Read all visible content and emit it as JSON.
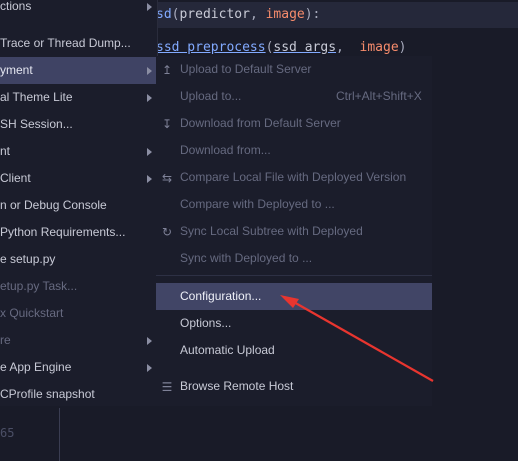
{
  "editor": {
    "line1": {
      "fn": "sd",
      "open": "(",
      "arg1": "predictor",
      "comma": ",",
      "arg2": "image",
      "close": "):"
    },
    "line2": {
      "fn": "ssd",
      "fn_rest": " preprocess",
      "open": "(",
      "arg1": "ssd args",
      "comma": ",",
      "arg2": "image",
      "close": ")"
    },
    "line3": "' ' ' ' ' ' ' ' '",
    "gutter_number": "65"
  },
  "parent_menu": {
    "items": [
      {
        "label": "ctions",
        "has_submenu": true,
        "disabled": false,
        "selected": false
      },
      {
        "label": " Trace or Thread Dump...",
        "has_submenu": false,
        "disabled": false,
        "selected": false
      },
      {
        "label": "yment",
        "has_submenu": true,
        "disabled": false,
        "selected": true
      },
      {
        "label": "al Theme Lite",
        "has_submenu": true,
        "disabled": false,
        "selected": false
      },
      {
        "label": "SH Session...",
        "has_submenu": false,
        "disabled": false,
        "selected": false
      },
      {
        "label": "nt",
        "has_submenu": true,
        "disabled": false,
        "selected": false
      },
      {
        "label": " Client",
        "has_submenu": true,
        "disabled": false,
        "selected": false
      },
      {
        "label": "n or Debug Console",
        "has_submenu": false,
        "disabled": false,
        "selected": false
      },
      {
        "label": "Python Requirements...",
        "has_submenu": false,
        "disabled": false,
        "selected": false
      },
      {
        "label": "e setup.py",
        "has_submenu": false,
        "disabled": false,
        "selected": false
      },
      {
        "label": "etup.py Task...",
        "has_submenu": false,
        "disabled": true,
        "selected": false
      },
      {
        "label": "x Quickstart",
        "has_submenu": false,
        "disabled": true,
        "selected": false
      },
      {
        "label": "re",
        "has_submenu": true,
        "disabled": true,
        "selected": false
      },
      {
        "label": "e App Engine",
        "has_submenu": true,
        "disabled": false,
        "selected": false
      },
      {
        "label": "CProfile snapshot",
        "has_submenu": false,
        "disabled": false,
        "selected": false
      }
    ]
  },
  "submenu": {
    "items": [
      {
        "label": "Upload to Default Server",
        "icon": "upload-icon",
        "icon_glyph": "↥",
        "disabled": true,
        "shortcut": ""
      },
      {
        "label": "Upload to...",
        "icon": "",
        "icon_glyph": "",
        "disabled": true,
        "shortcut": "Ctrl+Alt+Shift+X"
      },
      {
        "label": "Download from Default Server",
        "icon": "download-icon",
        "icon_glyph": "↧",
        "disabled": true,
        "shortcut": ""
      },
      {
        "label": "Download from...",
        "icon": "",
        "icon_glyph": "",
        "disabled": true,
        "shortcut": ""
      },
      {
        "label": "Compare Local File with Deployed Version",
        "icon": "compare-icon",
        "icon_glyph": "⇆",
        "disabled": true,
        "shortcut": ""
      },
      {
        "label": "Compare with Deployed to ...",
        "icon": "",
        "icon_glyph": "",
        "disabled": true,
        "shortcut": ""
      },
      {
        "label": "Sync Local Subtree with Deployed",
        "icon": "sync-icon",
        "icon_glyph": "↻",
        "disabled": true,
        "shortcut": ""
      },
      {
        "label": "Sync with Deployed to ...",
        "icon": "",
        "icon_glyph": "",
        "disabled": true,
        "shortcut": ""
      },
      {
        "label": "Configuration...",
        "icon": "",
        "icon_glyph": "",
        "disabled": false,
        "selected": true,
        "shortcut": ""
      },
      {
        "label": "Options...",
        "icon": "",
        "icon_glyph": "",
        "disabled": false,
        "shortcut": ""
      },
      {
        "label": "Automatic Upload",
        "icon": "",
        "icon_glyph": "",
        "disabled": false,
        "shortcut": ""
      },
      {
        "label": "Browse Remote Host",
        "icon": "remote-host-icon",
        "icon_glyph": "☰",
        "disabled": false,
        "shortcut": ""
      }
    ]
  },
  "colors": {
    "background": "#1b1d2b",
    "selection": "#414566",
    "annotation_arrow": "#e8352f"
  }
}
